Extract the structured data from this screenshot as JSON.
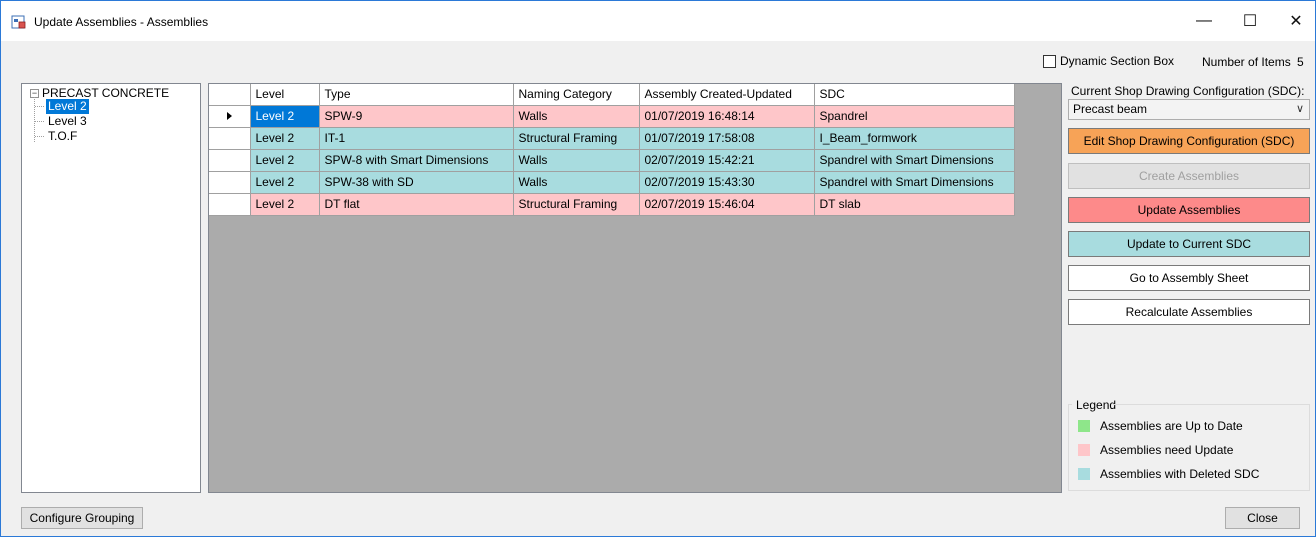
{
  "window": {
    "title": "Update Assemblies - Assemblies",
    "minimize": "—",
    "maximize": "☐",
    "close": "✕"
  },
  "options": {
    "dynamic_section_box_label": "Dynamic Section Box",
    "dynamic_section_box_checked": false,
    "number_of_items_label": "Number of Items",
    "number_of_items_value": "5"
  },
  "tree": {
    "root": "PRECAST CONCRETE",
    "children": [
      "Level 2",
      "Level 3",
      "T.O.F"
    ],
    "selected": "Level 2"
  },
  "grid": {
    "columns": [
      "Level",
      "Type",
      "Naming Category",
      "Assembly Created-Updated",
      "SDC"
    ],
    "rows": [
      {
        "status": "pink",
        "level": "Level 2",
        "type": "SPW-9",
        "category": "Walls",
        "date": "01/07/2019 16:48:14",
        "sdc": "Spandrel"
      },
      {
        "status": "cyan",
        "level": "Level 2",
        "type": "IT-1",
        "category": "Structural Framing",
        "date": "01/07/2019 17:58:08",
        "sdc": "I_Beam_formwork"
      },
      {
        "status": "cyan",
        "level": "Level 2",
        "type": "SPW-8 with Smart Dimensions",
        "category": "Walls",
        "date": "02/07/2019 15:42:21",
        "sdc": "Spandrel with Smart Dimensions"
      },
      {
        "status": "cyan",
        "level": "Level 2",
        "type": "SPW-38 with SD",
        "category": "Walls",
        "date": "02/07/2019 15:43:30",
        "sdc": "Spandrel with Smart Dimensions"
      },
      {
        "status": "pink",
        "level": "Level 2",
        "type": "DT flat",
        "category": "Structural Framing",
        "date": "02/07/2019 15:46:04",
        "sdc": "DT slab"
      }
    ]
  },
  "panel": {
    "sdc_label": "Current Shop Drawing Configuration (SDC):",
    "sdc_value": "Precast beam",
    "edit_sdc": "Edit Shop Drawing Configuration (SDC)",
    "create_assemblies": "Create Assemblies",
    "update_assemblies": "Update Assemblies",
    "update_to_current_sdc": "Update to Current SDC",
    "go_to_assembly_sheet": "Go to Assembly Sheet",
    "recalculate_assemblies": "Recalculate Assemblies"
  },
  "legend": {
    "title": "Legend",
    "items": [
      {
        "label": "Assemblies are Up to Date",
        "color": "#8ee68a"
      },
      {
        "label": "Assemblies need Update",
        "color": "#fec6c9"
      },
      {
        "label": "Assemblies with Deleted SDC",
        "color": "#a8dcdf"
      }
    ]
  },
  "footer": {
    "configure_grouping": "Configure Grouping",
    "close": "Close"
  },
  "colors": {
    "need_update": "#fec6c9",
    "deleted_sdc": "#a8dcdf",
    "selection": "#0078d7",
    "edit_button": "#f7a357",
    "update_button": "#fd8a8a"
  }
}
